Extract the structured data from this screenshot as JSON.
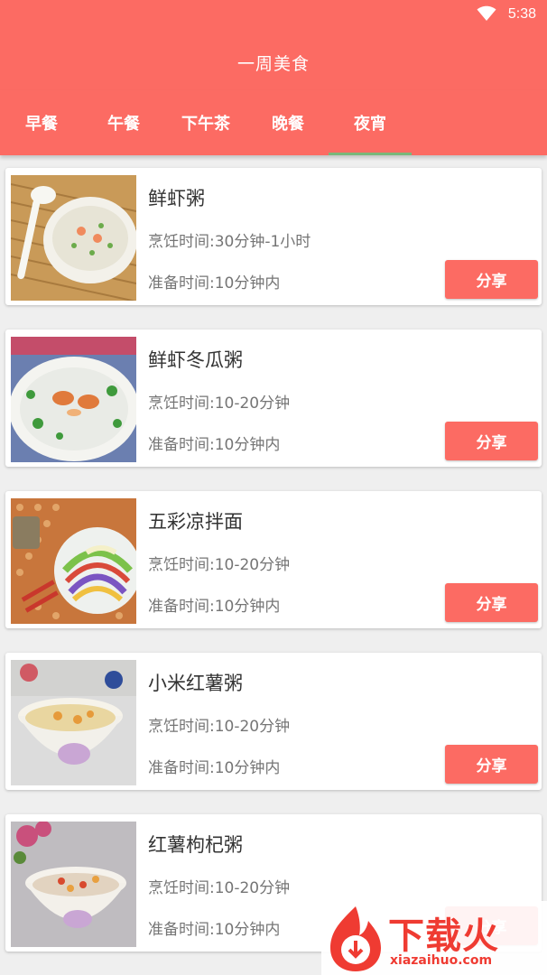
{
  "status": {
    "time": "5:38",
    "wifi_icon": "wifi-icon"
  },
  "header": {
    "title": "一周美食"
  },
  "tabs": [
    {
      "label": "早餐"
    },
    {
      "label": "午餐"
    },
    {
      "label": "下午茶"
    },
    {
      "label": "晚餐"
    },
    {
      "label": "夜宵",
      "selected": true
    }
  ],
  "recipes": [
    {
      "name": "鲜虾粥",
      "cook_time": "烹饪时间:30分钟-1小时",
      "prep_time": "准备时间:10分钟内",
      "share_label": "分享"
    },
    {
      "name": "鲜虾冬瓜粥",
      "cook_time": "烹饪时间:10-20分钟",
      "prep_time": "准备时间:10分钟内",
      "share_label": "分享"
    },
    {
      "name": "五彩凉拌面",
      "cook_time": "烹饪时间:10-20分钟",
      "prep_time": "准备时间:10分钟内",
      "share_label": "分享"
    },
    {
      "name": "小米红薯粥",
      "cook_time": "烹饪时间:10-20分钟",
      "prep_time": "准备时间:10分钟内",
      "share_label": "分享"
    },
    {
      "name": "红薯枸杞粥",
      "cook_time": "烹饪时间:10-20分钟",
      "prep_time": "准备时间:10分钟内",
      "share_label": "分享"
    }
  ],
  "watermark": {
    "brand": "下载火",
    "url": "xiazaihuo.com"
  },
  "colors": {
    "primary": "#fc6b63",
    "tab_indicator": "#7ab77a",
    "background": "#efefef"
  }
}
